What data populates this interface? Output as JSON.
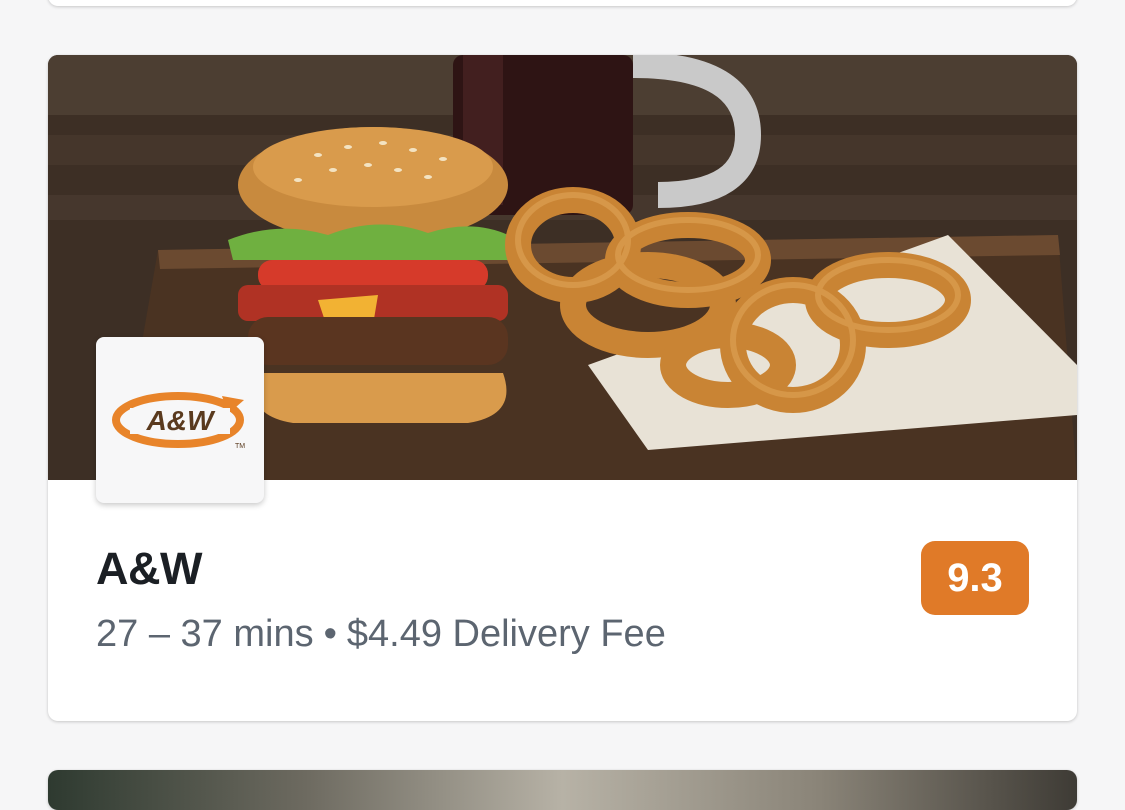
{
  "store": {
    "name": "A&W",
    "delivery_time": "27 – 37 mins",
    "separator": "•",
    "delivery_fee": "$4.49 Delivery Fee",
    "rating": "9.3",
    "logo_text": "A&W",
    "logo_tm": "TM",
    "brand_colors": {
      "orange": "#e07a28",
      "logo_orange": "#e8842a",
      "logo_brown": "#5a3a1e"
    }
  },
  "hero_image": {
    "subject": "burger, onion rings and root beer mug"
  }
}
